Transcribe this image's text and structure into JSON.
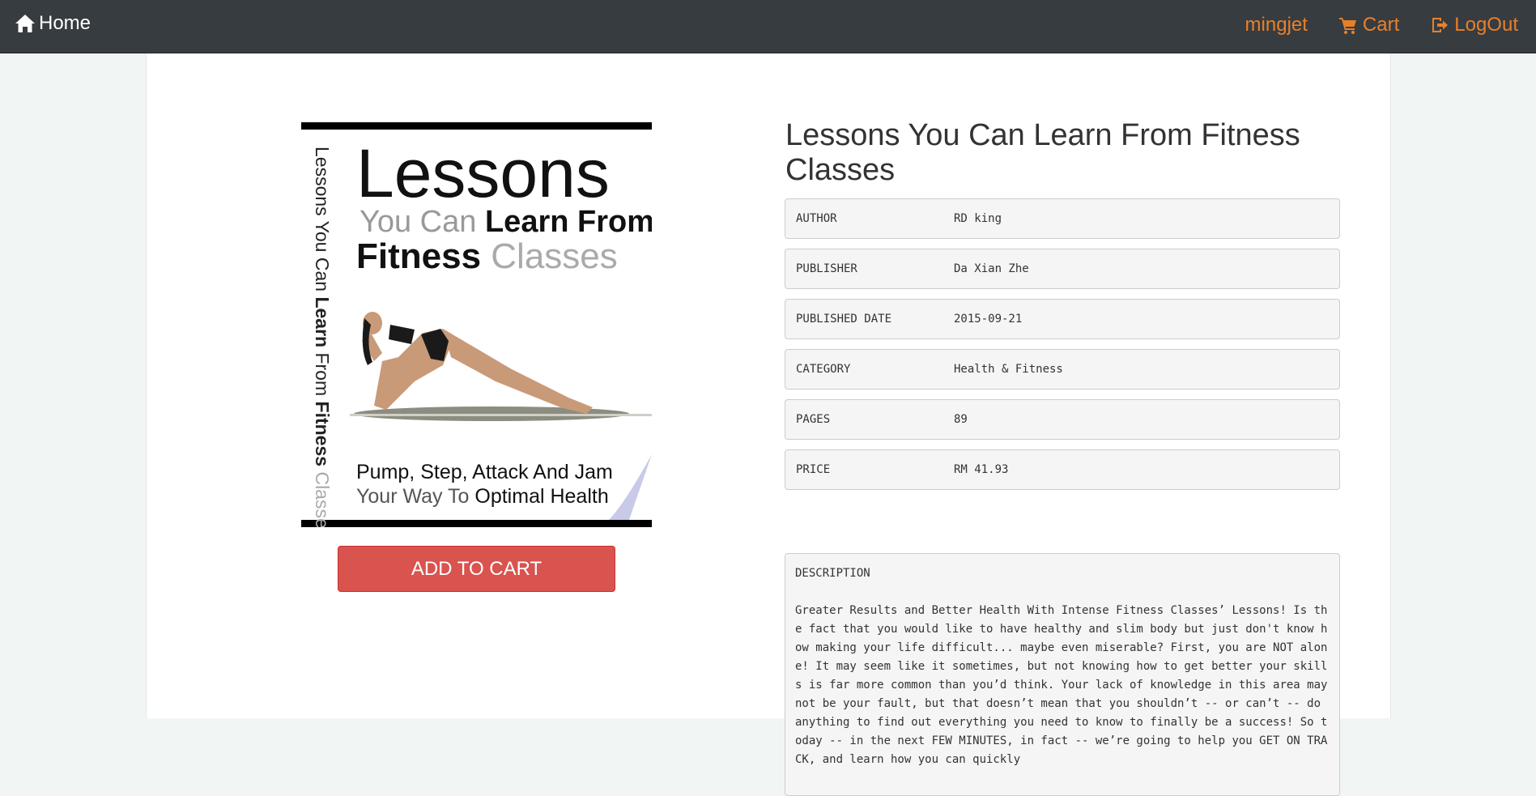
{
  "nav": {
    "home_label": "Home",
    "username": "mingjet",
    "cart_label": "Cart",
    "logout_label": "LogOut",
    "accent_color": "#e8802a"
  },
  "book": {
    "title": "Lessons You Can Learn From Fitness Classes",
    "add_to_cart_label": "ADD TO CART",
    "cover": {
      "line1": "Lessons",
      "line2a": "You Can",
      "line2b": "Learn From",
      "line3a": "Fitness",
      "line3b": "Classes",
      "side_a": "Lessons You Can",
      "side_b": "Learn",
      "side_c": "From",
      "side_d": "Fitness",
      "side_e": "Classes",
      "bottom1": "Pump, Step, Attack And Jam",
      "bottom2a": "Your Way To",
      "bottom2b": "Optimal Health"
    },
    "fields": [
      {
        "label": "AUTHOR",
        "value": "RD king"
      },
      {
        "label": "PUBLISHER",
        "value": "Da Xian Zhe"
      },
      {
        "label": "PUBLISHED DATE",
        "value": "2015-09-21"
      },
      {
        "label": "CATEGORY",
        "value": "Health & Fitness"
      },
      {
        "label": "PAGES",
        "value": "89"
      },
      {
        "label": "PRICE",
        "value": "RM 41.93"
      }
    ],
    "description_label": "DESCRIPTION",
    "description": "Greater Results and Better Health With Intense Fitness Classes’ Lessons! Is the fact that you would like to have healthy and slim body but just don't know how making your life difficult... maybe even miserable? First, you are NOT alone! It may seem like it sometimes, but not knowing how to get better your skills is far more common than you’d think. Your lack of knowledge in this area may not be your fault, but that doesn’t mean that you shouldn’t -- or can’t -- do anything to find out everything you need to know to finally be a success! So today -- in the next FEW MINUTES, in fact -- we’re going to help you GET ON TRACK, and learn how you can quickly"
  }
}
